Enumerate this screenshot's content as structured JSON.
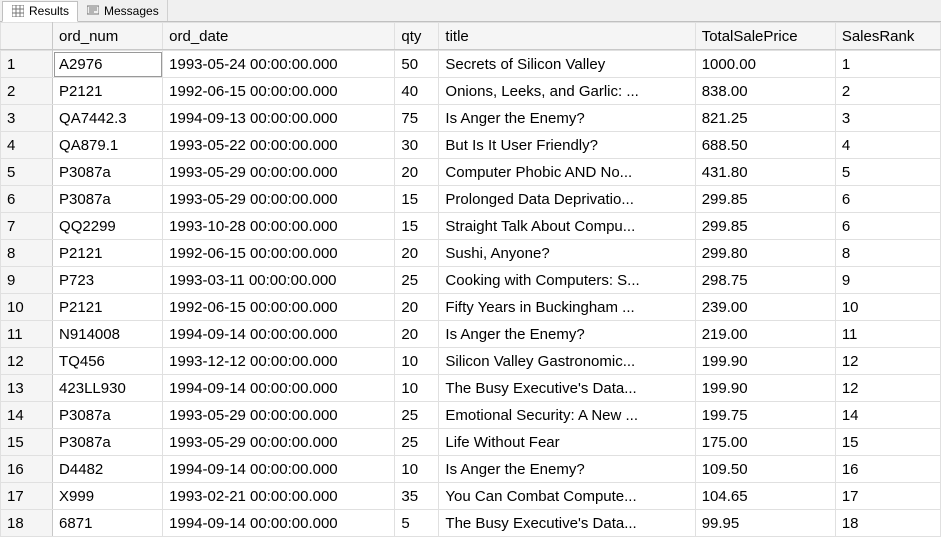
{
  "tabs": {
    "results": "Results",
    "messages": "Messages"
  },
  "columns": {
    "rownum": "",
    "ord_num": "ord_num",
    "ord_date": "ord_date",
    "qty": "qty",
    "title": "title",
    "TotalSalePrice": "TotalSalePrice",
    "SalesRank": "SalesRank"
  },
  "rows": [
    {
      "n": "1",
      "ord_num": "A2976",
      "ord_date": "1993-05-24 00:00:00.000",
      "qty": "50",
      "title": "Secrets of Silicon Valley",
      "TotalSalePrice": "1000.00",
      "SalesRank": "1"
    },
    {
      "n": "2",
      "ord_num": "P2121",
      "ord_date": "1992-06-15 00:00:00.000",
      "qty": "40",
      "title": "Onions, Leeks, and Garlic: ...",
      "TotalSalePrice": "838.00",
      "SalesRank": "2"
    },
    {
      "n": "3",
      "ord_num": "QA7442.3",
      "ord_date": "1994-09-13 00:00:00.000",
      "qty": "75",
      "title": "Is Anger the Enemy?",
      "TotalSalePrice": "821.25",
      "SalesRank": "3"
    },
    {
      "n": "4",
      "ord_num": "QA879.1",
      "ord_date": "1993-05-22 00:00:00.000",
      "qty": "30",
      "title": "But Is It User Friendly?",
      "TotalSalePrice": "688.50",
      "SalesRank": "4"
    },
    {
      "n": "5",
      "ord_num": "P3087a",
      "ord_date": "1993-05-29 00:00:00.000",
      "qty": "20",
      "title": "Computer Phobic AND No...",
      "TotalSalePrice": "431.80",
      "SalesRank": "5"
    },
    {
      "n": "6",
      "ord_num": "P3087a",
      "ord_date": "1993-05-29 00:00:00.000",
      "qty": "15",
      "title": "Prolonged Data Deprivatio...",
      "TotalSalePrice": "299.85",
      "SalesRank": "6"
    },
    {
      "n": "7",
      "ord_num": "QQ2299",
      "ord_date": "1993-10-28 00:00:00.000",
      "qty": "15",
      "title": "Straight Talk About Compu...",
      "TotalSalePrice": "299.85",
      "SalesRank": "6"
    },
    {
      "n": "8",
      "ord_num": "P2121",
      "ord_date": "1992-06-15 00:00:00.000",
      "qty": "20",
      "title": "Sushi, Anyone?",
      "TotalSalePrice": "299.80",
      "SalesRank": "8"
    },
    {
      "n": "9",
      "ord_num": "P723",
      "ord_date": "1993-03-11 00:00:00.000",
      "qty": "25",
      "title": "Cooking with Computers: S...",
      "TotalSalePrice": "298.75",
      "SalesRank": "9"
    },
    {
      "n": "10",
      "ord_num": "P2121",
      "ord_date": "1992-06-15 00:00:00.000",
      "qty": "20",
      "title": "Fifty Years in Buckingham ...",
      "TotalSalePrice": "239.00",
      "SalesRank": "10"
    },
    {
      "n": "11",
      "ord_num": "N914008",
      "ord_date": "1994-09-14 00:00:00.000",
      "qty": "20",
      "title": "Is Anger the Enemy?",
      "TotalSalePrice": "219.00",
      "SalesRank": "11"
    },
    {
      "n": "12",
      "ord_num": "TQ456",
      "ord_date": "1993-12-12 00:00:00.000",
      "qty": "10",
      "title": "Silicon Valley Gastronomic...",
      "TotalSalePrice": "199.90",
      "SalesRank": "12"
    },
    {
      "n": "13",
      "ord_num": "423LL930",
      "ord_date": "1994-09-14 00:00:00.000",
      "qty": "10",
      "title": "The Busy Executive's Data...",
      "TotalSalePrice": "199.90",
      "SalesRank": "12"
    },
    {
      "n": "14",
      "ord_num": "P3087a",
      "ord_date": "1993-05-29 00:00:00.000",
      "qty": "25",
      "title": "Emotional Security: A New ...",
      "TotalSalePrice": "199.75",
      "SalesRank": "14"
    },
    {
      "n": "15",
      "ord_num": "P3087a",
      "ord_date": "1993-05-29 00:00:00.000",
      "qty": "25",
      "title": "Life Without Fear",
      "TotalSalePrice": "175.00",
      "SalesRank": "15"
    },
    {
      "n": "16",
      "ord_num": "D4482",
      "ord_date": "1994-09-14 00:00:00.000",
      "qty": "10",
      "title": "Is Anger the Enemy?",
      "TotalSalePrice": "109.50",
      "SalesRank": "16"
    },
    {
      "n": "17",
      "ord_num": "X999",
      "ord_date": "1993-02-21 00:00:00.000",
      "qty": "35",
      "title": "You Can Combat Compute...",
      "TotalSalePrice": "104.65",
      "SalesRank": "17"
    },
    {
      "n": "18",
      "ord_num": "6871",
      "ord_date": "1994-09-14 00:00:00.000",
      "qty": "5",
      "title": "The Busy Executive's Data...",
      "TotalSalePrice": "99.95",
      "SalesRank": "18"
    }
  ]
}
